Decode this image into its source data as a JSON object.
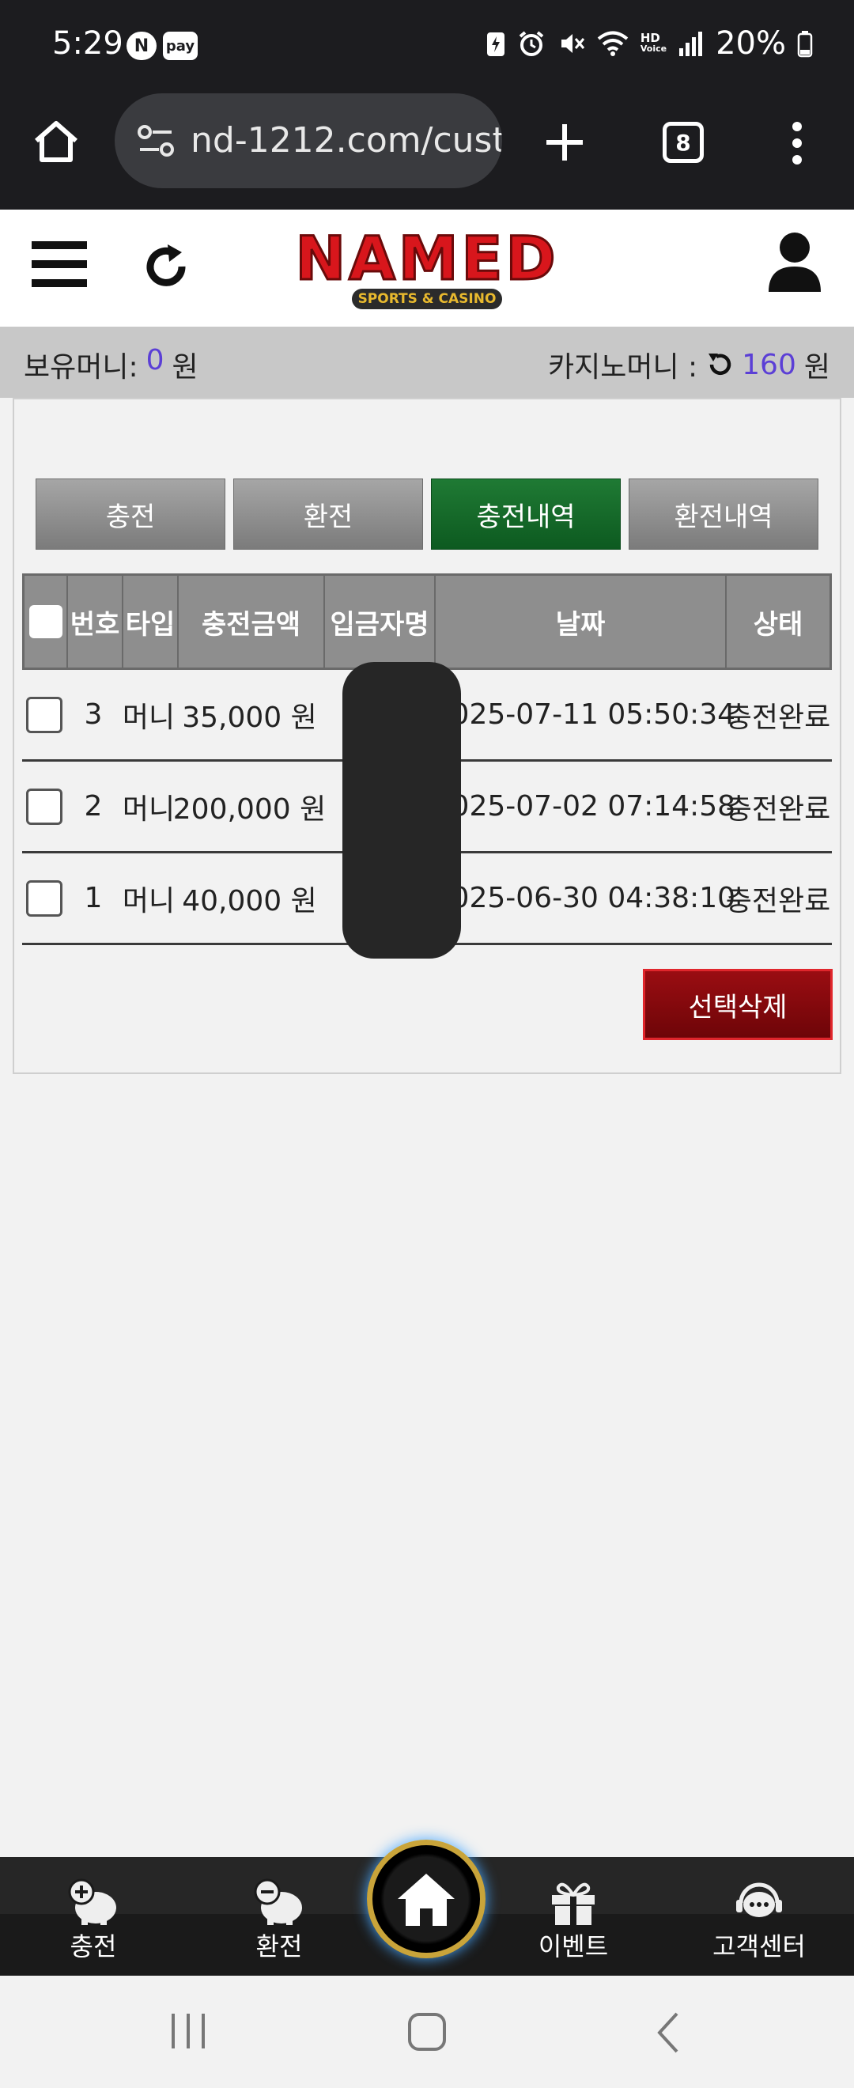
{
  "status": {
    "time": "5:29",
    "n_badge": "N",
    "pay_badge": "pay",
    "hd_label": "HD",
    "voice_label": "Voice",
    "battery": "20%"
  },
  "browser": {
    "url": "nd-1212.com/cust",
    "tab_count": "8"
  },
  "site": {
    "logo_text": "NAMED",
    "logo_subtitle": "SPORTS & CASINO"
  },
  "balance": {
    "label": "보유머니:",
    "value": "0",
    "unit": "원",
    "casino_label": "카지노머니 :",
    "casino_value": "160",
    "casino_unit": "원",
    "value_color": "#5b3fd6"
  },
  "tabs": [
    {
      "label": "충전",
      "active": false
    },
    {
      "label": "환전",
      "active": false
    },
    {
      "label": "충전내역",
      "active": true
    },
    {
      "label": "환전내역",
      "active": false
    }
  ],
  "table": {
    "headers": [
      "번호",
      "타입",
      "충전금액",
      "입금자명",
      "날짜",
      "상태"
    ],
    "rows": [
      {
        "num": "3",
        "type": "머니",
        "amount": "35,000 원",
        "depositor": "",
        "date": "2025-07-11 05:50:34",
        "status": "충전완료"
      },
      {
        "num": "2",
        "type": "머니",
        "amount": "200,000 원",
        "depositor": "",
        "date": "2025-07-02 07:14:58",
        "status": "충전완료"
      },
      {
        "num": "1",
        "type": "머니",
        "amount": "40,000 원",
        "depositor": "",
        "date": "2025-06-30 04:38:10",
        "status": "충전완료"
      }
    ]
  },
  "delete_button": "선택삭제",
  "bottom_nav": {
    "charge": "충전",
    "exchange": "환전",
    "event": "이벤트",
    "support": "고객센터"
  }
}
